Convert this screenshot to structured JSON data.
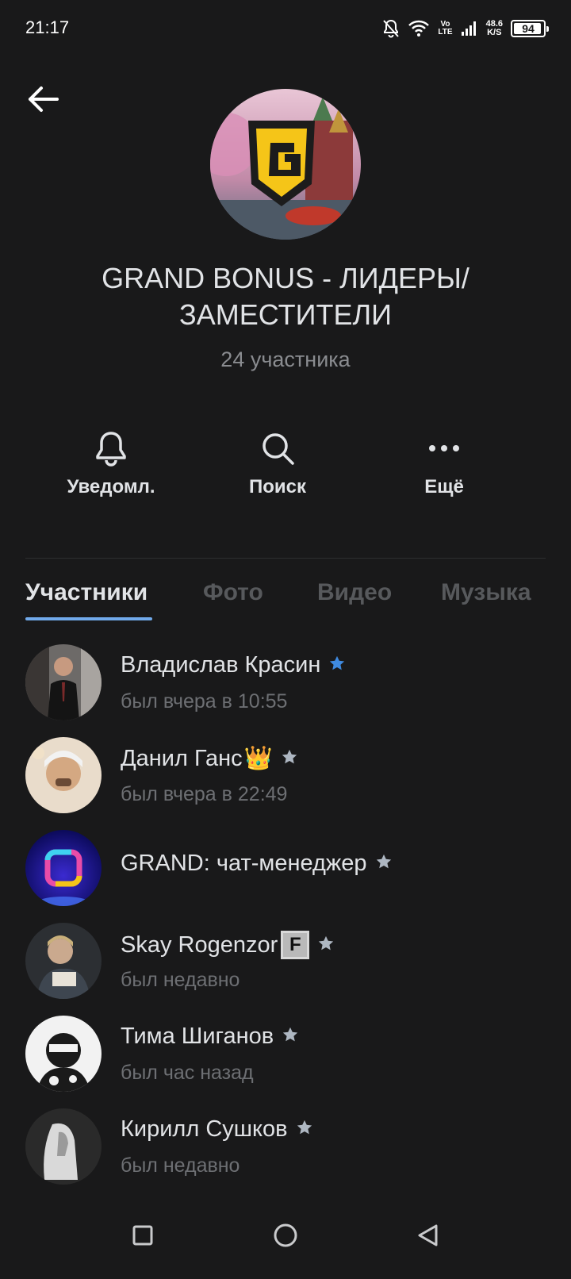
{
  "status_bar": {
    "time": "21:17",
    "network_label_top": "Vo",
    "network_label_bottom": "LTE",
    "speed_value": "48.6",
    "speed_unit": "K/S",
    "battery": "94",
    "battery_level": 0.94,
    "icons": [
      "bell-off-icon",
      "wifi-icon",
      "signal-icon",
      "battery-icon"
    ]
  },
  "header": {
    "back_icon": "arrow-left-icon",
    "title_line1": "GRAND BONUS - ЛИДЕРЫ/",
    "title_line2": "ЗАМЕСТИТЕЛИ",
    "subtitle": "24 участника"
  },
  "actions": [
    {
      "icon": "bell-icon",
      "label": "Уведомл."
    },
    {
      "icon": "search-icon",
      "label": "Поиск"
    },
    {
      "icon": "more-icon",
      "label": "Ещё"
    }
  ],
  "tabs": [
    {
      "label": "Участники",
      "active": true
    },
    {
      "label": "Фото",
      "active": false
    },
    {
      "label": "Видео",
      "active": false
    },
    {
      "label": "Музыка",
      "active": false
    }
  ],
  "members": [
    {
      "name": "Владислав Красин",
      "badge": "",
      "star_color": "#3f8ae0",
      "status": "был вчера в 10:55"
    },
    {
      "name": "Данил Ганс",
      "badge": "👑",
      "star_color": "#aeb7c2",
      "status": "был вчера в 22:49"
    },
    {
      "name": "GRAND: чат-менеджер",
      "badge": "",
      "star_color": "#aeb7c2",
      "status": ""
    },
    {
      "name": "Skay Rogenzor",
      "badge": "F",
      "star_color": "#aeb7c2",
      "status": "был недавно"
    },
    {
      "name": "Тима Шиганов",
      "badge": "",
      "star_color": "#aeb7c2",
      "status": "был час назад"
    },
    {
      "name": "Кирилл Сушков",
      "badge": "",
      "star_color": "#aeb7c2",
      "status": "был недавно"
    }
  ],
  "colors": {
    "background": "#19191a",
    "accent": "#71aaeb",
    "text_primary": "#e1e3e6",
    "text_secondary": "#6d6f73",
    "logo_yellow": "#f5c518"
  },
  "navbar": [
    "square-icon",
    "circle-icon",
    "triangle-back-icon"
  ]
}
